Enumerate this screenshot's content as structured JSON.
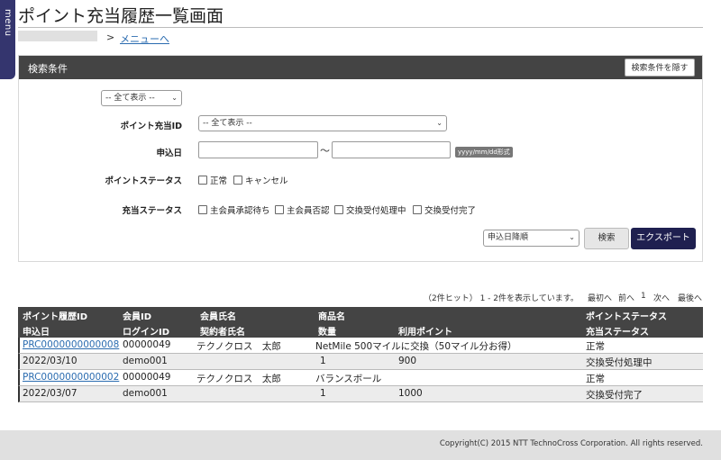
{
  "menu_tab": {
    "label": "menu"
  },
  "header": {
    "title": "ポイント充当履歴一覧画面",
    "breadcrumb_sep": ">",
    "breadcrumb_link": "メニューへ"
  },
  "search_panel": {
    "title": "検索条件",
    "hide_button": "検索条件を隠す",
    "top_select": "-- 全て表示 --",
    "point_id_label": "ポイント充当ID",
    "point_id_select": "-- 全て表示 --",
    "apply_date_label": "申込日",
    "date_tilde": "〜",
    "date_format_hint": "yyyy/mm/dd形式",
    "point_status_label": "ポイントステータス",
    "point_status_options": [
      "正常",
      "キャンセル"
    ],
    "apply_status_label": "充当ステータス",
    "apply_status_options": [
      "主会員承認待ち",
      "主会員否認",
      "交換受付処理中",
      "交換受付完了"
    ],
    "sort_select": "申込日降順",
    "search_button": "検索",
    "export_button": "エクスポート"
  },
  "results": {
    "hit_info": "（2件ヒット） 1 - 2件を表示しています。",
    "pager": {
      "first": "最初へ",
      "prev": "前へ",
      "page": "1",
      "next": "次へ",
      "last": "最後へ"
    },
    "headers_row1": [
      "ポイント履歴ID",
      "会員ID",
      "会員氏名",
      "商品名",
      "ポイントステータス"
    ],
    "headers_row2": [
      "申込日",
      "ログインID",
      "契約者氏名",
      "数量",
      "利用ポイント",
      "充当ステータス"
    ],
    "records": [
      {
        "id": "PRC0000000000008",
        "member_id": "00000049",
        "member_name": "テクノクロス　太郎",
        "product": "NetMile 500マイルに交換（50マイル分お得）",
        "point_status": "正常",
        "date": "2022/03/10",
        "login_id": "demo001",
        "contractor": "",
        "qty": "1",
        "points": "900",
        "apply_status": "交換受付処理中"
      },
      {
        "id": "PRC0000000000002",
        "member_id": "00000049",
        "member_name": "テクノクロス　太郎",
        "product": "バランスボール",
        "point_status": "正常",
        "date": "2022/03/07",
        "login_id": "demo001",
        "contractor": "",
        "qty": "1",
        "points": "1000",
        "apply_status": "交換受付完了"
      }
    ]
  },
  "footer": {
    "copyright": "Copyright(C) 2015 NTT TechnoCross Corporation. All rights reserved."
  },
  "colors": {
    "header_bg": "#444444",
    "menu_bg": "#34356e",
    "export_bg": "#1f2050",
    "link": "#2b6cb0"
  }
}
